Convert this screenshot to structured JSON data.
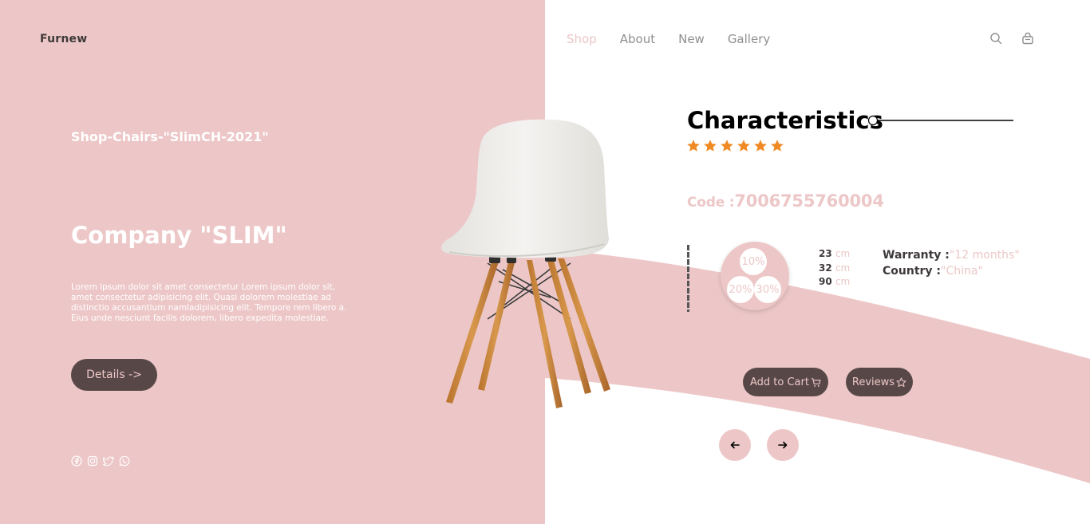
{
  "brand": {
    "logo": "Furnew"
  },
  "nav": {
    "items": [
      {
        "label": "Shop",
        "active": true
      },
      {
        "label": "About"
      },
      {
        "label": "New"
      },
      {
        "label": "Gallery"
      }
    ],
    "icons": [
      "search-icon",
      "shopping-bag-icon"
    ]
  },
  "hero": {
    "breadcrumb": "Shop-Chairs-\"SlimCH-2021\"",
    "company": "Company \"SLIM\"",
    "description": "Lorem ipsum dolor sit amet consectetur Lorem ipsum dolor sit, amet consectetur adipisicing elit. Quasi dolorem molestiae ad distinctio accusantium namladipisicing elit. Tempore rem libero a. Eius unde nesciunt facilis dolorem, libero expedita molestiae.",
    "details_button": "Details ->"
  },
  "socials": [
    "facebook-icon",
    "instagram-icon",
    "twitter-icon",
    "whatsapp-icon"
  ],
  "product": {
    "title": "Characteristics",
    "rating": 6,
    "code_label": "Code :",
    "code_value": "7006755760004",
    "discounts": [
      "10%",
      "20%",
      "30%"
    ],
    "dimensions": [
      {
        "value": "23",
        "unit": "cm"
      },
      {
        "value": "32",
        "unit": "cm"
      },
      {
        "value": "90",
        "unit": "cm"
      }
    ],
    "warranty_label": "Warranty :",
    "warranty_value": "\"12 months\"",
    "country_label": "Country :",
    "country_value": "\"China\"",
    "cart_button": "Add to Cart",
    "reviews_button": "Reviews"
  },
  "colors": {
    "pink": "#edc7c7",
    "dark": "#574847",
    "star": "#f08a24",
    "text": "#3f3a3a"
  }
}
